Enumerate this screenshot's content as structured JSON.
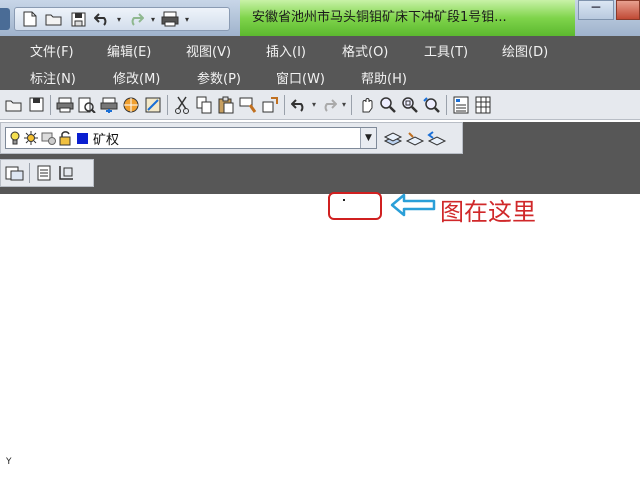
{
  "window": {
    "title": "安徽省池州市马头铜钼矿床下冲矿段1号钼...",
    "minimize_glyph": "─"
  },
  "quick_access": {
    "items": [
      "new-file-icon",
      "open-folder-icon",
      "save-icon",
      "undo-icon",
      "redo-icon",
      "plot-icon"
    ]
  },
  "menu": {
    "row1": [
      "文件(F)",
      "编辑(E)",
      "视图(V)",
      "插入(I)",
      "格式(O)",
      "工具(T)",
      "绘图(D)"
    ],
    "row2": [
      "标注(N)",
      "修改(M)",
      "参数(P)",
      "窗口(W)",
      "帮助(H)"
    ]
  },
  "layers": {
    "current_layer": "矿权",
    "layer_color": "#0a1fd0"
  },
  "annotation": {
    "text": "图在这里",
    "color": "#d0282a"
  },
  "ucs": {
    "y_label": "Y"
  }
}
